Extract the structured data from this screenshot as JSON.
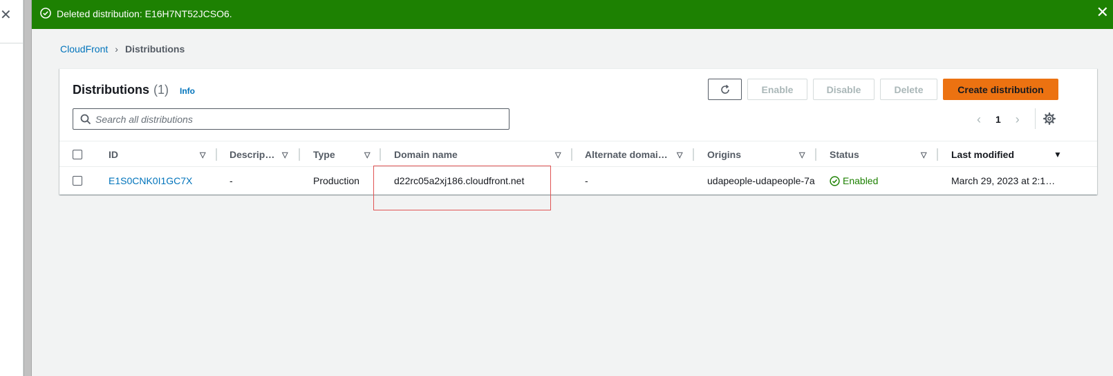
{
  "flash": {
    "message": "Deleted distribution: E16H7NT52JCSO6.",
    "dismiss_glyph": "✕",
    "color": "#1d8102"
  },
  "side": {
    "close_glyph": "✕"
  },
  "breadcrumb": {
    "root": "CloudFront",
    "separator": "›",
    "current": "Distributions"
  },
  "panel": {
    "title": "Distributions",
    "count": "(1)",
    "info": "Info"
  },
  "actions": {
    "enable": "Enable",
    "disable": "Disable",
    "delete": "Delete",
    "create": "Create distribution",
    "accent": "#ec7211"
  },
  "search": {
    "placeholder": "Search all distributions",
    "value": ""
  },
  "pagination": {
    "prev": "‹",
    "page": "1",
    "next": "›"
  },
  "table": {
    "columns": {
      "id": "ID",
      "description": "Descrip…",
      "type": "Type",
      "domain": "Domain name",
      "alternate": "Alternate domai…",
      "origins": "Origins",
      "status": "Status",
      "last_modified": "Last modified"
    },
    "rows": [
      {
        "id": "E1S0CNK0I1GC7X",
        "description": "-",
        "type": "Production",
        "domain": "d22rc05a2xj186.cloudfront.net",
        "alternate": "-",
        "origins": "udapeople-udapeople-7a",
        "status": "Enabled",
        "last_modified": "March 29, 2023 at 2:1…"
      }
    ]
  },
  "icons": [
    "check-circle-icon",
    "close-icon",
    "refresh-icon",
    "search-icon",
    "settings-gear-icon",
    "sort-icon"
  ]
}
